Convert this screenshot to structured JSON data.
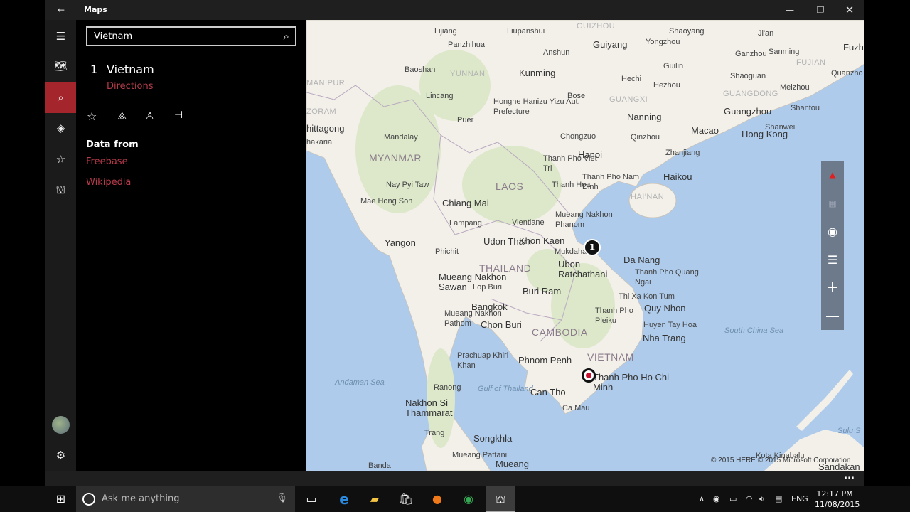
{
  "window": {
    "title": "Maps",
    "back_icon": "arrow-left-icon",
    "controls": [
      "minimize",
      "restore",
      "close"
    ]
  },
  "rail": {
    "items": [
      {
        "name": "hamburger-icon"
      },
      {
        "name": "map-icon"
      },
      {
        "name": "search-icon",
        "active": true
      },
      {
        "name": "directions-icon"
      },
      {
        "name": "favorites-icon"
      },
      {
        "name": "3d-cities-icon"
      }
    ],
    "bottom": [
      {
        "name": "avatar"
      },
      {
        "name": "settings-icon"
      }
    ],
    "accent": "#a4262c"
  },
  "search": {
    "value": "Vietnam"
  },
  "result": {
    "number": "1",
    "name": "Vietnam",
    "directions": "Directions",
    "actions": [
      "favorite",
      "share",
      "3d-view",
      "pin-to-start"
    ]
  },
  "data_from": {
    "heading": "Data from",
    "sources": [
      "Freebase",
      "Wikipedia"
    ]
  },
  "map": {
    "labels": [
      "Lijiang",
      "Liupanshui",
      "GUIZHOU",
      "Guiyang",
      "Shaoyang",
      "Ji'an",
      "Fuzh",
      "Panzhihua",
      "Anshun",
      "Yongzhou",
      "Ganzhou",
      "Sanming",
      "Baoshan",
      "YUNNAN",
      "Kunming",
      "Guilin",
      "FUJIAN",
      "Quanzho",
      "MANIPUR",
      "Hechi",
      "Hezhou",
      "Shaoguan",
      "Meizhou",
      "Lincang",
      "Honghe Hanizu Yizu Aut. Prefecture",
      "Bose",
      "GUANGXI",
      "GUANGDONG",
      "ZORAM",
      "Puer",
      "Nanning",
      "Guangzhou",
      "Shantou",
      "hittagong",
      "Mandalay",
      "Chongzuo",
      "Qinzhou",
      "Macao",
      "Hong Kong",
      "Shanwei",
      "hakaria",
      "MYANMAR",
      "Thanh Pho Viet Tri",
      "Hanoi",
      "Zhanjiang",
      "Haikou",
      "Thanh Pho Nam Dinh",
      "Nay Pyi Taw",
      "LAOS",
      "Thanh Hoa",
      "HAI'NAN",
      "Mae Hong Son",
      "Chiang Mai",
      "Mueang Nakhon Phanom",
      "Vientiane",
      "Lampang",
      "Udon Thani",
      "Khon Kaen",
      "Mukdahan",
      "Yangon",
      "Phichit",
      "Da Nang",
      "Ubon Ratchathani",
      "Thanh Pho Quang Ngai",
      "THAILAND",
      "Mueang Nakhon Sawan",
      "Lop Buri",
      "Buri Ram",
      "Thi Xa Kon Tum",
      "Quy Nhon",
      "Bangkok",
      "Thanh Pho Pleiku",
      "Mueang Nakhon Pathom",
      "Chon Buri",
      "CAMBODIA",
      "Huyen Tay Hoa",
      "Nha Trang",
      "South China Sea",
      "VIETNAM",
      "Prachuap Khiri Khan",
      "Phnom Penh",
      "Thanh Pho Ho Chi Minh",
      "Andaman Sea",
      "Ranong",
      "Gulf of Thailand",
      "Can Tho",
      "Ca Mau",
      "Nakhon Si Thammarat",
      "Trang",
      "Songkhla",
      "Sulu S",
      "Banda",
      "Mueang Pattani",
      "Mueang",
      "Kota Kinabalu",
      "Sandakan"
    ],
    "pin_number": "1",
    "copyright": "© 2015 HERE © 2015 Microsoft Corporation",
    "controls": [
      "compass-icon",
      "tilt-icon",
      "locate-icon",
      "layers-icon",
      "zoom-in-icon",
      "zoom-out-icon"
    ],
    "colors": {
      "sea": "#aecbeb",
      "land": "#f3f0ea",
      "forest": "#dce8c9",
      "pin": "#c8102e"
    }
  },
  "appbar": {
    "more": "..."
  },
  "taskbar": {
    "cortana_placeholder": "Ask me anything",
    "language": "ENG",
    "time": "12:17 PM",
    "date": "11/08/2015"
  }
}
